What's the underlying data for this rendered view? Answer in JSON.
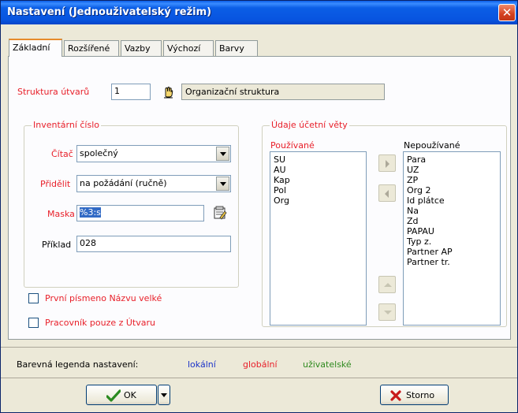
{
  "window": {
    "title": "Nastavení (Jednouživatelský režim)",
    "close_glyph": "✕"
  },
  "tabs": [
    {
      "label": "Základní",
      "active": true
    },
    {
      "label": "Rozšířené"
    },
    {
      "label": "Vazby"
    },
    {
      "label": "Výchozí"
    },
    {
      "label": "Barvy"
    }
  ],
  "struktura": {
    "label": "Struktura útvarů",
    "value": "1",
    "name_value": "Organizační struktura",
    "pick_icon": "hand-pointer-icon"
  },
  "inventarni": {
    "legend": "Inventární číslo",
    "citac_label": "Čítač",
    "citac_value": "společný",
    "pridelit_label": "Přidělit",
    "pridelit_value": "na požádání (ručně)",
    "maska_label": "Maska",
    "maska_value": "%3:s",
    "maska_icon": "edit-mask-icon",
    "priklad_label": "Příklad",
    "priklad_value": "028"
  },
  "ucetni": {
    "legend": "Údaje účetní věty",
    "used_label": "Používané",
    "used_items": [
      "SU",
      "AU",
      "Kap",
      "Pol",
      "Org"
    ],
    "unused_label": "Nepoužívané",
    "unused_items": [
      "Para",
      "UZ",
      "ZP",
      "Org 2",
      "Id plátce",
      "Na",
      "Zd",
      "PAPAU",
      "Typ z.",
      "Partner AP",
      "Partner tr."
    ]
  },
  "options": {
    "prvni_pismeno": {
      "label": "První písmeno Názvu velké",
      "checked": false
    },
    "pracovnik": {
      "label": "Pracovník pouze z Útvaru",
      "checked": false
    }
  },
  "legend_bar": {
    "label": "Barevná legenda nastavení:",
    "local": "lokální",
    "global": "globální",
    "user": "uživatelské",
    "colors": {
      "local": "#1a32c8",
      "global": "#e8202a",
      "user": "#2f8a1f"
    }
  },
  "footer": {
    "ok_label": "OK",
    "storno_label": "Storno"
  },
  "colors": {
    "title_bar": "#0854e0",
    "required_label": "#e8202a",
    "selection": "#316ac5"
  }
}
